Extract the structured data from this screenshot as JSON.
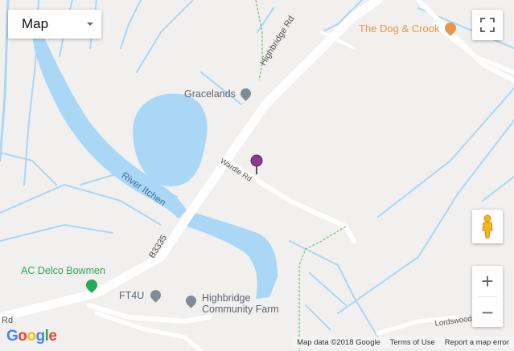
{
  "map": {
    "type_selector": "Map",
    "labels": {
      "dog_crook": "The Dog & Crook",
      "gracelands": "Gracelands",
      "highbridge_rd": "Highbridge Rd",
      "wardle_rd": "Wardle Rd",
      "river_itchen": "River Itchen",
      "b3335": "B3335",
      "ac_delco": "AC Delco Bowmen",
      "ft4u": "FT4U",
      "highbridge_farm_line1": "Highbridge",
      "highbridge_farm_line2": "Community Farm",
      "lordswood": "Lordswood",
      "rd_fragment": "Rd"
    },
    "icons": {
      "gracelands": "place-pin-icon",
      "dog_crook": "pub-pin-icon",
      "ac_delco": "sports-pin-icon",
      "ft4u": "place-pin-icon",
      "highbridge_farm": "place-pin-icon",
      "marker": "map-marker-icon"
    },
    "colors": {
      "land": "#f2f0ef",
      "water": "#a9d7f5",
      "road": "#ffffff",
      "pub": "#e8964b",
      "park": "#2aa85a",
      "marker": "#8a3b8f",
      "poi_grey": "#7f8c95",
      "path": "#7bbf7b"
    }
  },
  "controls": {
    "zoom_in": "+",
    "zoom_out": "−"
  },
  "footer": {
    "logo": "Google",
    "map_data": "Map data ©2018 Google",
    "terms": "Terms of Use",
    "report": "Report a map error"
  }
}
